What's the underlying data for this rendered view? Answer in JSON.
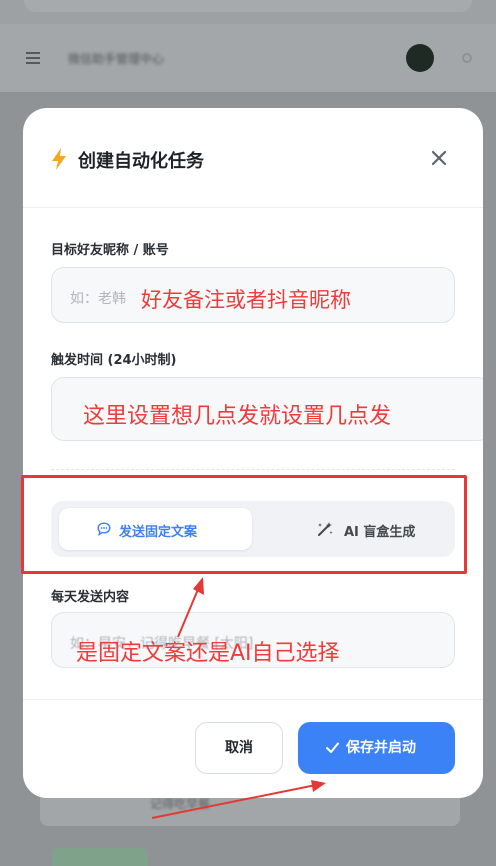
{
  "background": {
    "title": "微信助手管理中心",
    "bottom_text": "记得吃早餐"
  },
  "modal": {
    "title": "创建自动化任务",
    "icons": {
      "title_icon": "lightning-bolt-icon",
      "close": "close-icon"
    },
    "fields": {
      "friend": {
        "label": "目标好友昵称 / 账号",
        "placeholder": "如：老韩"
      },
      "time": {
        "label": "触发时间 (24小时制)",
        "value": ""
      },
      "content": {
        "label": "每天发送内容",
        "placeholder": "如：早安，记得吃早餐 [太阳]"
      }
    },
    "mode_toggle": {
      "fixed_label": "发送固定文案",
      "fixed_icon": "chat-bubble-icon",
      "ai_label": "AI 盲盒生成",
      "ai_icon": "magic-wand-icon",
      "selected": "fixed"
    },
    "buttons": {
      "cancel": "取消",
      "save": "保存并启动",
      "save_icon": "check-icon"
    }
  },
  "annotations": {
    "friend_note": "好友备注或者抖音昵称",
    "time_note": "这里设置想几点发就设置几点发",
    "mode_note": "是固定文案还是AI自己选择"
  },
  "colors": {
    "primary": "#3b82f6",
    "annotation_red": "#ef3b39",
    "bolt": "#f5a623",
    "overlay": "#8f9396"
  }
}
